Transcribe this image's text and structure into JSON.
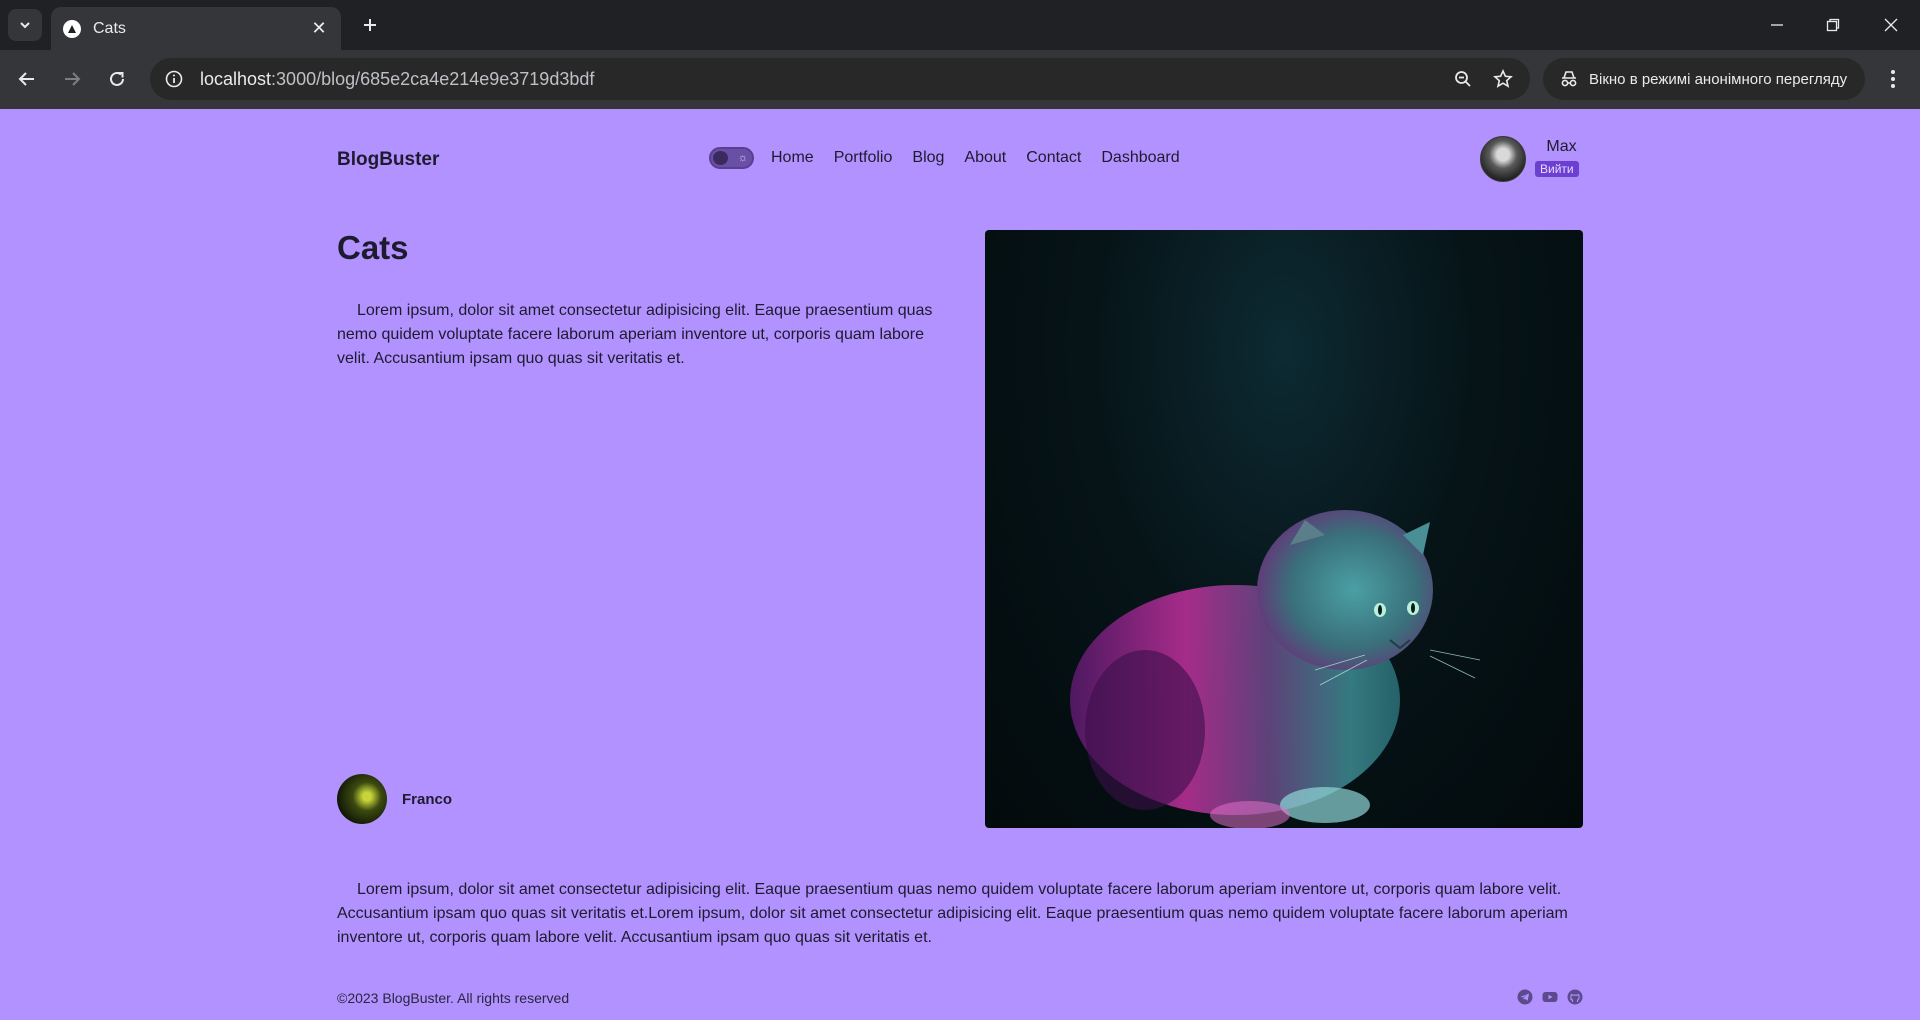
{
  "browser": {
    "tab_title": "Cats",
    "url_host": "localhost",
    "url_path": ":3000/blog/685e2ca4e214e9e3719d3bdf",
    "incognito_label": "Вікно в режимі анонімного перегляду"
  },
  "header": {
    "logo": "BlogBuster",
    "nav": [
      "Home",
      "Portfolio",
      "Blog",
      "About",
      "Contact",
      "Dashboard"
    ],
    "user_name": "Max",
    "logout_label": "Вийти"
  },
  "post": {
    "title": "Cats",
    "intro": "Lorem ipsum, dolor sit amet consectetur adipisicing elit. Eaque praesentium quas nemo quidem voluptate facere laborum aperiam inventore ut, corporis quam labore velit. Accusantium ipsam quo quas sit veritatis et.",
    "author": "Franco",
    "body": "Lorem ipsum, dolor sit amet consectetur adipisicing elit. Eaque praesentium quas nemo quidem voluptate facere laborum aperiam inventore ut, corporis quam labore velit. Accusantium ipsam quo quas sit veritatis et.Lorem ipsum, dolor sit amet consectetur adipisicing elit. Eaque praesentium quas nemo quidem voluptate facere laborum aperiam inventore ut, corporis quam labore velit. Accusantium ipsam quo quas sit veritatis et."
  },
  "footer": {
    "copyright": "©2023 BlogBuster. All rights reserved",
    "social_icons": [
      "telegram-icon",
      "youtube-icon",
      "github-icon"
    ]
  },
  "colors": {
    "page_bg": "#b292ff",
    "chrome_bg": "#202124",
    "logout_bg": "#6a3fd1"
  }
}
